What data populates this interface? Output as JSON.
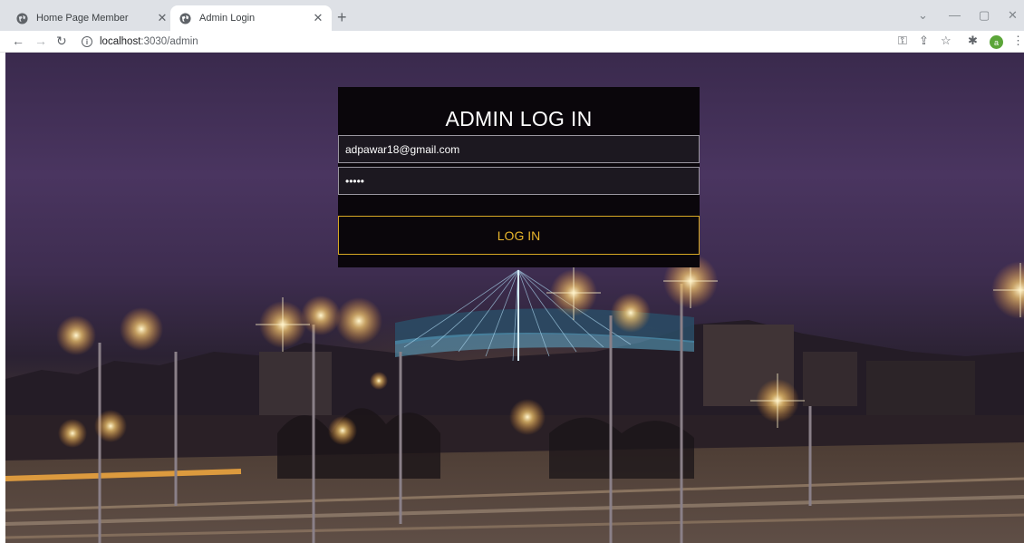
{
  "browser": {
    "tabs": [
      {
        "title": "Home Page Member",
        "active": false
      },
      {
        "title": "Admin Login",
        "active": true
      }
    ],
    "url_host": "localhost",
    "url_path": ":3030/admin",
    "avatar_letter": "a",
    "accent_colors": {
      "avatar": "#5ba538"
    }
  },
  "login": {
    "title": "ADMIN LOG IN",
    "email_value": "adpawar18@gmail.com",
    "password_value": "•••••",
    "button_label": "LOG IN",
    "button_color": "#e8b52c"
  }
}
